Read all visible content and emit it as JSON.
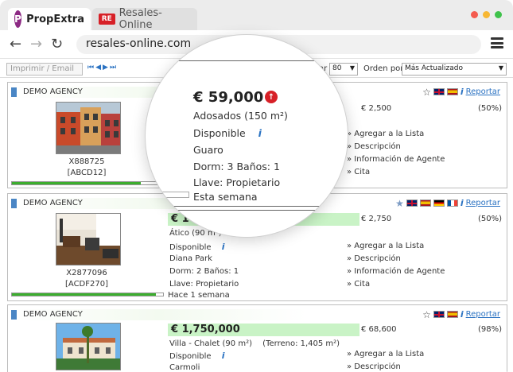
{
  "browser": {
    "tabs": [
      {
        "label": "PropExtra",
        "logo": "P"
      },
      {
        "label": "Resales-Online",
        "logo": "RE"
      }
    ],
    "url": "resales-online.com"
  },
  "toolbar": {
    "print_email": "Imprimir / Email",
    "show_label": "Mostrar",
    "show_value": "80",
    "order_label": "Orden por",
    "order_value": "Más Actualizado"
  },
  "listings": [
    {
      "agency": "DEMO AGENCY",
      "flags": [
        "uk",
        "es"
      ],
      "report": "Reportar",
      "ref": "X888725",
      "code": "[ABCD12]",
      "commission": "€ 2,500",
      "pct": "(50%)",
      "progress": 0.85,
      "links": [
        "» Agregar a la Lista",
        "» Descripción",
        "» Información de Agente",
        "» Cita"
      ]
    },
    {
      "agency": "DEMO AGENCY",
      "flags": [
        "uk",
        "es",
        "de",
        "fr"
      ],
      "report": "Reportar",
      "price": "€ 1",
      "type": "Ático (90 m²)",
      "status": "Disponible",
      "location": "Diana Park",
      "rooms": "Dorm: 2 Baños: 1",
      "key": "Llave: Propietario",
      "ref": "X2877096",
      "code": "[ACDF270]",
      "updated": "Hace 1 semana",
      "commission": "€ 2,750",
      "pct": "(50%)",
      "progress": 0.95,
      "links": [
        "» Agregar a la Lista",
        "» Descripción",
        "» Información de Agente",
        "» Cita"
      ]
    },
    {
      "agency": "DEMO AGENCY",
      "flags": [
        "uk",
        "es"
      ],
      "report": "Reportar",
      "price": "€ 1,750,000",
      "type": "Villa - Chalet (90 m²)",
      "terrain": "(Terreno: 1,405 m²)",
      "status": "Disponible",
      "location": "Carmoli",
      "commission": "€ 68,600",
      "pct": "(98%)",
      "links": [
        "» Agregar a la Lista",
        "» Descripción"
      ]
    }
  ],
  "magnifier": {
    "price": "€ 59,000",
    "type": "Adosados (150 m²)",
    "status": "Disponible",
    "location": "Guaro",
    "rooms": "Dorm: 3 Baños: 1",
    "key": "Llave: Propietario",
    "updated": "Esta semana"
  },
  "colors": {
    "accent_blue": "#2a72c2",
    "price_bg": "#c9f3c6",
    "progress_green": "#3cae2e",
    "brand_purple": "#8d2a84",
    "brand_red": "#d72027"
  }
}
